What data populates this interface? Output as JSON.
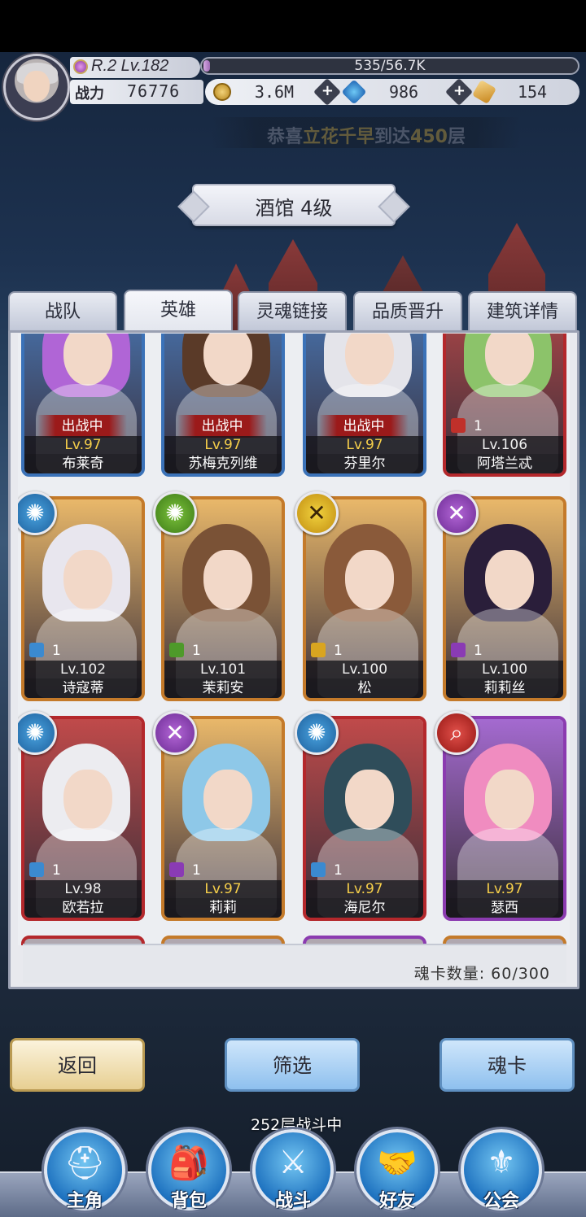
{
  "header": {
    "rank_level": "R.2 Lv.182",
    "xp": "535/56.7K",
    "xp_fraction": 0.0094,
    "power_label": "战力",
    "power_value": "76776",
    "gold": "3.6M",
    "gems": "986",
    "tickets": "154",
    "announcement_prefix": "恭喜",
    "announcement_name": "立花千早",
    "announcement_middle": "到达",
    "announcement_floor": "450",
    "announcement_suffix": "层"
  },
  "title": "酒馆 4级",
  "tabs": [
    "战队",
    "英雄",
    "灵魂链接",
    "品质晋升",
    "建筑详情"
  ],
  "active_tab": "英雄",
  "heroes": [
    {
      "name": "布莱奇",
      "level": "Lv.97",
      "badge": "出战中",
      "frame": "blue"
    },
    {
      "name": "苏梅克列维",
      "level": "Lv.97",
      "badge": "出战中",
      "frame": "blue"
    },
    {
      "name": "芬里尔",
      "level": "Lv.97",
      "badge": "出战中",
      "frame": "blue"
    },
    {
      "name": "阿塔兰忒",
      "level": "Lv.106",
      "rank": "1",
      "frame": "red"
    },
    {
      "name": "诗寇蒂",
      "level": "Lv.102",
      "rank": "1",
      "element": "blue",
      "frame": "gold"
    },
    {
      "name": "茉莉安",
      "level": "Lv.101",
      "rank": "1",
      "element": "green",
      "frame": "gold"
    },
    {
      "name": "松",
      "level": "Lv.100",
      "rank": "1",
      "element": "yellow",
      "frame": "gold"
    },
    {
      "name": "莉莉丝",
      "level": "Lv.100",
      "rank": "1",
      "element": "purple",
      "frame": "gold"
    },
    {
      "name": "欧若拉",
      "level": "Lv.98",
      "rank": "1",
      "element": "blue",
      "frame": "red"
    },
    {
      "name": "莉莉",
      "level": "Lv.97",
      "rank": "1",
      "element": "purple",
      "frame": "gold"
    },
    {
      "name": "海尼尔",
      "level": "Lv.97",
      "rank": "1",
      "element": "blue",
      "frame": "red"
    },
    {
      "name": "瑟西",
      "level": "Lv.97",
      "rank": "",
      "element": "red",
      "frame": "purple"
    }
  ],
  "card_count_label": "魂卡数量: 60/300",
  "buttons": {
    "back": "返回",
    "filter": "筛选",
    "soul_card": "魂卡"
  },
  "battle_status": {
    "floor": "252",
    "floor_unit": "层",
    "status": "战斗中"
  },
  "nav": [
    "主角",
    "背包",
    "战斗",
    "好友",
    "公会"
  ],
  "colors": {
    "frame_gold": "#c47a2a",
    "frame_red": "#b4282c",
    "frame_blue": "#3b72b8",
    "frame_purple": "#8b3bb0",
    "level_gold": "#f6cf4a"
  }
}
